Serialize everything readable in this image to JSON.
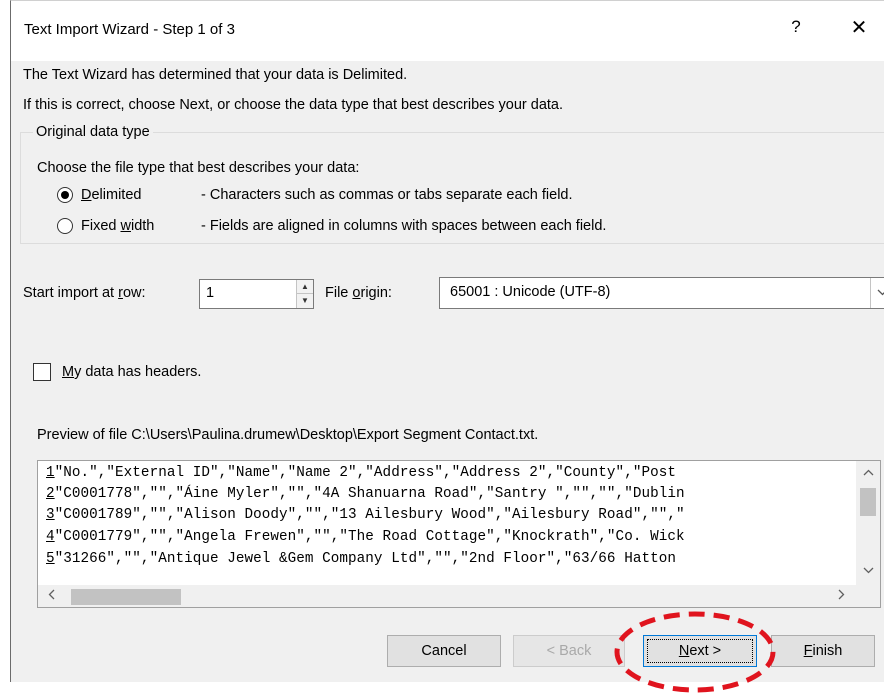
{
  "window": {
    "title": "Text Import Wizard - Step 1 of 3",
    "help_glyph": "?",
    "close_glyph": "✕"
  },
  "intro": {
    "line1": "The Text Wizard has determined that your data is Delimited.",
    "line2": "If this is correct, choose Next, or choose the data type that best describes your data."
  },
  "data_type_group": {
    "label": "Original data type",
    "prompt": "Choose the file type that best describes your data:",
    "options": [
      {
        "label_accel": "D",
        "label_rest": "elimited",
        "description": "- Characters such as commas or tabs separate each field.",
        "selected": true
      },
      {
        "label_pre": "Fixed ",
        "label_accel": "w",
        "label_rest": "idth",
        "description": "- Fields are aligned in columns with spaces between each field.",
        "selected": false
      }
    ]
  },
  "start_row": {
    "label_pre": "Start import at ",
    "label_accel": "r",
    "label_rest": "ow:",
    "value": "1"
  },
  "file_origin": {
    "label_pre": "File ",
    "label_accel": "o",
    "label_rest": "rigin:",
    "value": "65001 : Unicode (UTF-8)"
  },
  "headers_checkbox": {
    "label_accel": "M",
    "label_rest": "y data has headers.",
    "checked": false
  },
  "preview": {
    "caption": "Preview of file C:\\Users\\Paulina.drumew\\Desktop\\Export Segment Contact.txt.",
    "rows": [
      {
        "num": "1",
        "text": "\"No.\",\"External ID\",\"Name\",\"Name 2\",\"Address\",\"Address 2\",\"County\",\"Post"
      },
      {
        "num": "2",
        "text": "\"C0001778\",\"\",\"Áine Myler\",\"\",\"4A Shanuarna Road\",\"Santry \",\"\",\"\",\"Dublin"
      },
      {
        "num": "3",
        "text": "\"C0001789\",\"\",\"Alison Doody\",\"\",\"13 Ailesbury Wood\",\"Ailesbury Road\",\"\",\""
      },
      {
        "num": "4",
        "text": "\"C0001779\",\"\",\"Angela Frewen\",\"\",\"The Road Cottage\",\"Knockrath\",\"Co. Wick"
      },
      {
        "num": "5",
        "text": "\"31266\",\"\",\"Antique Jewel &Gem Company Ltd\",\"\",\"2nd Floor\",\"63/66 Hatton"
      }
    ]
  },
  "buttons": {
    "cancel": "Cancel",
    "back": "< Back",
    "next_accel": "N",
    "next_rest": "ext >",
    "finish_accel": "F",
    "finish_rest": "inish"
  },
  "colors": {
    "dialog_bg": "#f0f0f0",
    "accent_border": "#0078d7",
    "annotation_red": "#e0141e"
  },
  "icons": {
    "spin_up": "▲",
    "spin_down": "▼",
    "dropdown": "⌄",
    "scroll_up": "˄",
    "scroll_down": "˅",
    "scroll_left": "‹",
    "scroll_right": "›"
  }
}
